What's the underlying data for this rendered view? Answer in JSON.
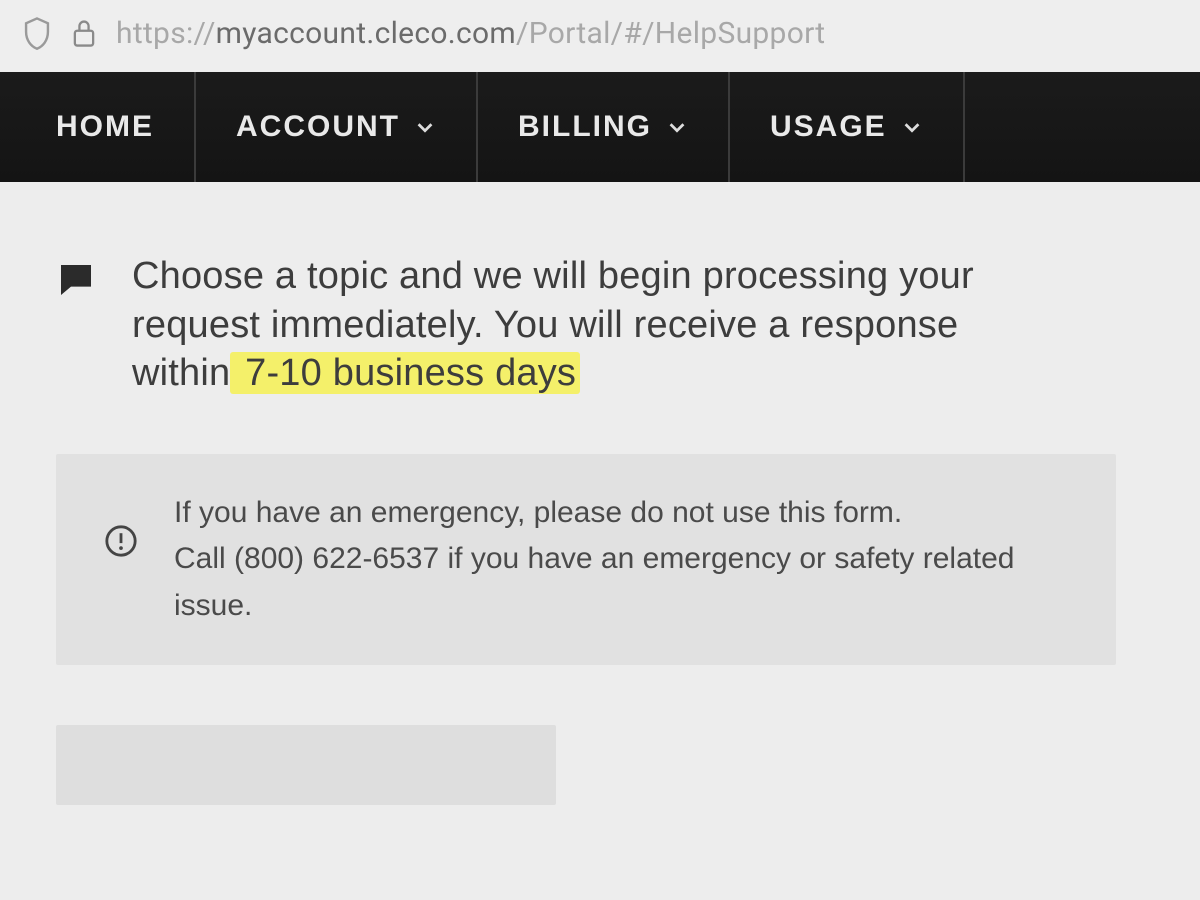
{
  "url": {
    "protocol": "https://",
    "host": "myaccount.cleco.com",
    "path": "/Portal/#/HelpSupport"
  },
  "nav": {
    "items": [
      {
        "label": "HOME",
        "has_dropdown": false
      },
      {
        "label": "ACCOUNT",
        "has_dropdown": true
      },
      {
        "label": "BILLING",
        "has_dropdown": true
      },
      {
        "label": "USAGE",
        "has_dropdown": true
      }
    ]
  },
  "intro": {
    "text_before_highlight": "Choose a topic and we will begin processing your request immediately. You will receive a response within",
    "highlighted_text": " 7-10 business days"
  },
  "alert": {
    "line1": "If you have an emergency, please do not use this form.",
    "line2": "Call (800) 622-6537 if you have an emergency or safety related issue."
  }
}
